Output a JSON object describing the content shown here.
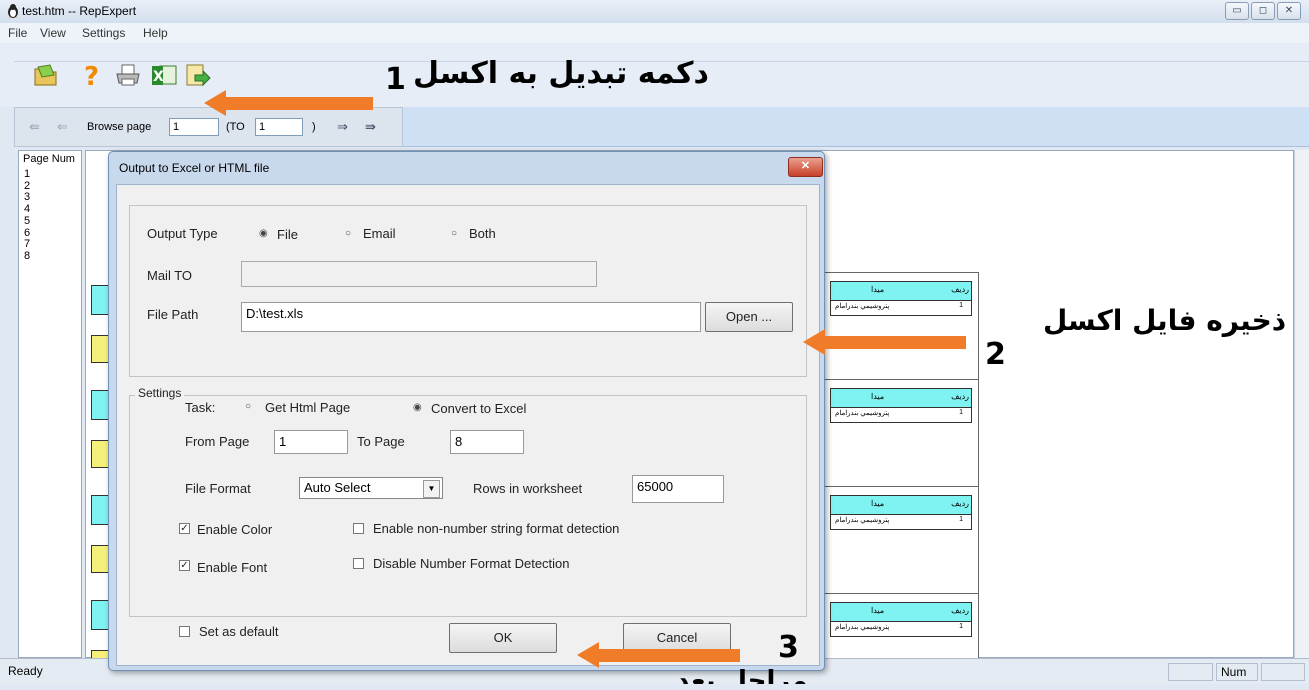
{
  "window": {
    "title": "test.htm -- RepExpert",
    "controls": [
      "minimize",
      "maximize",
      "close"
    ]
  },
  "menu": [
    "File",
    "View",
    "Settings",
    "Help"
  ],
  "navbar": {
    "browse_label": "Browse page",
    "from": "1",
    "to_label": "(TO",
    "to": "1",
    "close_paren": ")"
  },
  "pagelist": {
    "header": "Page Num",
    "pages": [
      "1",
      "2",
      "3",
      "4",
      "5",
      "6",
      "7",
      "8"
    ]
  },
  "preview_table": {
    "header_col1": "ميدا",
    "header_col2": "رديف",
    "row_text": "پتروشيمي بندرامام",
    "row_num": "1"
  },
  "dialog": {
    "title": "Output to Excel or HTML file",
    "output_type_label": "Output Type",
    "output_options": [
      "File",
      "Email",
      "Both"
    ],
    "output_selected": "File",
    "mail_to_label": "Mail TO",
    "mail_to_value": "",
    "file_path_label": "File Path",
    "file_path_value": "D:\\test.xls",
    "open_button": "Open ...",
    "settings_label": "Settings",
    "task_label": "Task:",
    "task_options": [
      "Get Html Page",
      "Convert to Excel"
    ],
    "task_selected": "Convert to Excel",
    "from_page_label": "From Page",
    "from_page_value": "1",
    "to_page_label": "To Page",
    "to_page_value": "8",
    "file_format_label": "File Format",
    "file_format_value": "Auto Select",
    "rows_label": "Rows in worksheet",
    "rows_value": "65000",
    "enable_color": "Enable Color",
    "enable_font": "Enable Font",
    "non_number_detect": "Enable non-number string format detection",
    "disable_number_detect": "Disable Number Format Detection",
    "set_default": "Set as default",
    "ok": "OK",
    "cancel": "Cancel"
  },
  "status": {
    "ready": "Ready",
    "num": "Num"
  },
  "annotations": {
    "a1_text": "دکمه تبدیل به اکسل",
    "a1_num": "1",
    "a2_text": "ذخیره فایل اکسل",
    "a2_num": "2",
    "a3_num": "3",
    "a3_text": "مراحل بعد"
  },
  "colors": {
    "arrow": "#f07b28",
    "cyan": "#7ff2f2",
    "yellow": "#f5f079"
  }
}
